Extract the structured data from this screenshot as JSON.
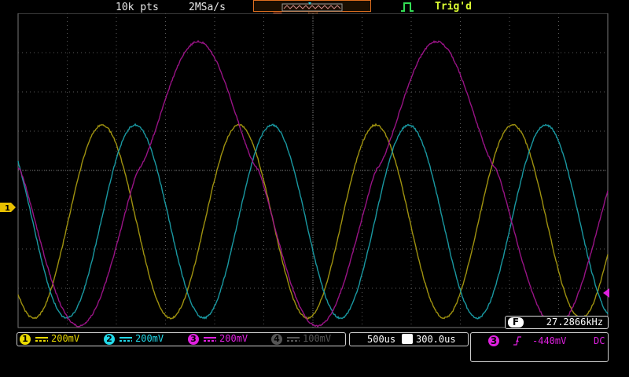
{
  "header": {
    "memory_depth": "10k pts",
    "sample_rate": "2MSa/s",
    "trigger_status": "Trig'd"
  },
  "channels": [
    {
      "num": "1",
      "scale": "200mV",
      "color": "#e8d800",
      "active": true
    },
    {
      "num": "2",
      "scale": "200mV",
      "color": "#22d8e8",
      "active": true
    },
    {
      "num": "3",
      "scale": "200mV",
      "color": "#e020e0",
      "active": true
    },
    {
      "num": "4",
      "scale": "100mV",
      "color": "#555555",
      "active": false
    }
  ],
  "timebase": {
    "scale": "500us",
    "h_label": "H",
    "offset": "300.0us"
  },
  "trigger": {
    "source": "3",
    "level": "-440mV",
    "coupling": "DC",
    "slope_icon": "rising-edge-icon"
  },
  "frequency": {
    "label": "F",
    "value": "27.2866kHz"
  },
  "markers": {
    "ch1_ground": "1"
  },
  "colors": {
    "grid": "#5a5a5a",
    "trace1": "#a89a10",
    "trace2": "#1aa0aa",
    "trace3": "#a0148c",
    "memory_border": "#e07020",
    "trig_ok": "#ddff33"
  }
}
